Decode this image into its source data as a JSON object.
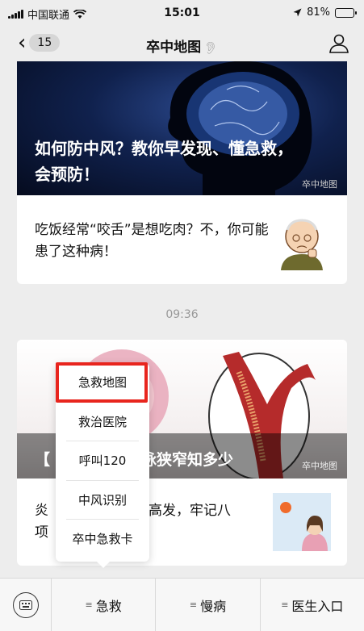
{
  "status_bar": {
    "carrier": "中国联通",
    "time": "15:01",
    "battery_percent": "81%",
    "battery_level": 0.81
  },
  "nav": {
    "back_count": "15",
    "title": "卒中地图"
  },
  "article1": {
    "banner_title": "如何防中风？教你早发现、懂急救，会预防！",
    "watermark": "卒中地图",
    "text": "吃饭经常“咬舌”是想吃肉？不，你可能患了这种病！"
  },
  "timestamp": "09:36",
  "article2": {
    "banner_title_left": "【",
    "banner_title_right": "脉狭窄知多少",
    "watermark": "卒中地图",
    "text_left": "炎",
    "text_right": "高发，牢记八",
    "text_line2": "项"
  },
  "popup_menu": {
    "items": [
      "急救地图",
      "救治医院",
      "呼叫120",
      "中风识别",
      "卒中急救卡"
    ],
    "highlighted_index": 0,
    "highlight_color": "#e8251e"
  },
  "tab_bar": {
    "tabs": [
      "急救",
      "慢病",
      "医生入口"
    ]
  }
}
